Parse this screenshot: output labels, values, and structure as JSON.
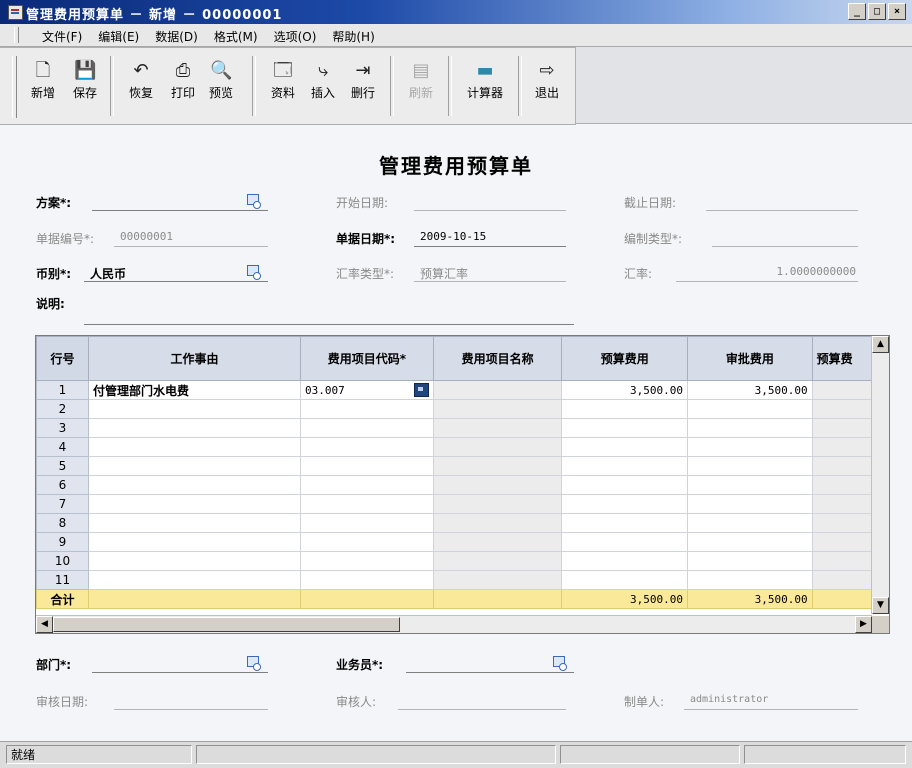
{
  "window": {
    "title": "管理费用预算单 － 新增 － 00000001",
    "controls": [
      "_",
      "□",
      "×"
    ]
  },
  "menu": [
    "文件(F)",
    "编辑(E)",
    "数据(D)",
    "格式(M)",
    "选项(O)",
    "帮助(H)"
  ],
  "toolbar": [
    {
      "label": "新增",
      "icon": "new-file-icon",
      "glyph": "🗋",
      "enabled": true
    },
    {
      "label": "保存",
      "icon": "save-icon",
      "glyph": "💾",
      "enabled": true
    },
    {
      "label": "恢复",
      "icon": "undo-icon",
      "glyph": "↶",
      "enabled": true
    },
    {
      "label": "打印",
      "icon": "print-icon",
      "glyph": "⎙",
      "enabled": true
    },
    {
      "label": "预览",
      "icon": "preview-icon",
      "glyph": "🔍",
      "enabled": true
    },
    {
      "label": "资料",
      "icon": "reference-icon",
      "glyph": "🗔",
      "enabled": true
    },
    {
      "label": "插入",
      "icon": "insert-row-icon",
      "glyph": "⤷",
      "enabled": true
    },
    {
      "label": "删行",
      "icon": "delete-row-icon",
      "glyph": "⇥",
      "enabled": true
    },
    {
      "label": "刷新",
      "icon": "refresh-icon",
      "glyph": "▤",
      "enabled": false
    },
    {
      "label": "计算器",
      "icon": "calculator-icon",
      "glyph": "▬",
      "enabled": true
    },
    {
      "label": "退出",
      "icon": "exit-icon",
      "glyph": "⇨",
      "enabled": true
    }
  ],
  "form": {
    "title": "管理费用预算单",
    "plan_label": "方案*:",
    "plan_value": "",
    "start_date_label": "开始日期:",
    "start_date_value": "",
    "end_date_label": "截止日期:",
    "end_date_value": "",
    "doc_no_label": "单据编号*:",
    "doc_no_value": "00000001",
    "doc_date_label": "单据日期*:",
    "doc_date_value": "2009-10-15",
    "compile_type_label": "编制类型*:",
    "compile_type_value": "",
    "currency_label": "币别*:",
    "currency_value": "人民币",
    "rate_type_label": "汇率类型*:",
    "rate_type_value": "预算汇率",
    "rate_label": "汇率:",
    "rate_value": "1.0000000000",
    "note_label": "说明:",
    "note_value": ""
  },
  "grid": {
    "columns": [
      "行号",
      "工作事由",
      "费用项目代码*",
      "费用项目名称",
      "预算费用",
      "审批费用",
      "预算费"
    ],
    "rows": [
      [
        "1",
        "付管理部门水电费",
        "03.007",
        "",
        "3,500.00",
        "3,500.00",
        ""
      ],
      [
        "2",
        "",
        "",
        "",
        "",
        "",
        ""
      ],
      [
        "3",
        "",
        "",
        "",
        "",
        "",
        ""
      ],
      [
        "4",
        "",
        "",
        "",
        "",
        "",
        ""
      ],
      [
        "5",
        "",
        "",
        "",
        "",
        "",
        ""
      ],
      [
        "6",
        "",
        "",
        "",
        "",
        "",
        ""
      ],
      [
        "7",
        "",
        "",
        "",
        "",
        "",
        ""
      ],
      [
        "8",
        "",
        "",
        "",
        "",
        "",
        ""
      ],
      [
        "9",
        "",
        "",
        "",
        "",
        "",
        ""
      ],
      [
        "10",
        "",
        "",
        "",
        "",
        "",
        ""
      ],
      [
        "11",
        "",
        "",
        "",
        "",
        "",
        ""
      ]
    ],
    "total": [
      "合计",
      "",
      "",
      "",
      "3,500.00",
      "3,500.00",
      ""
    ]
  },
  "footer": {
    "dept_label": "部门*:",
    "dept_value": "",
    "salesman_label": "业务员*:",
    "salesman_value": "",
    "audit_date_label": "审核日期:",
    "audit_date_value": "",
    "auditor_label": "审核人:",
    "auditor_value": "",
    "maker_label": "制单人:",
    "maker_value": "administrator"
  },
  "status": {
    "text": "就绪"
  }
}
